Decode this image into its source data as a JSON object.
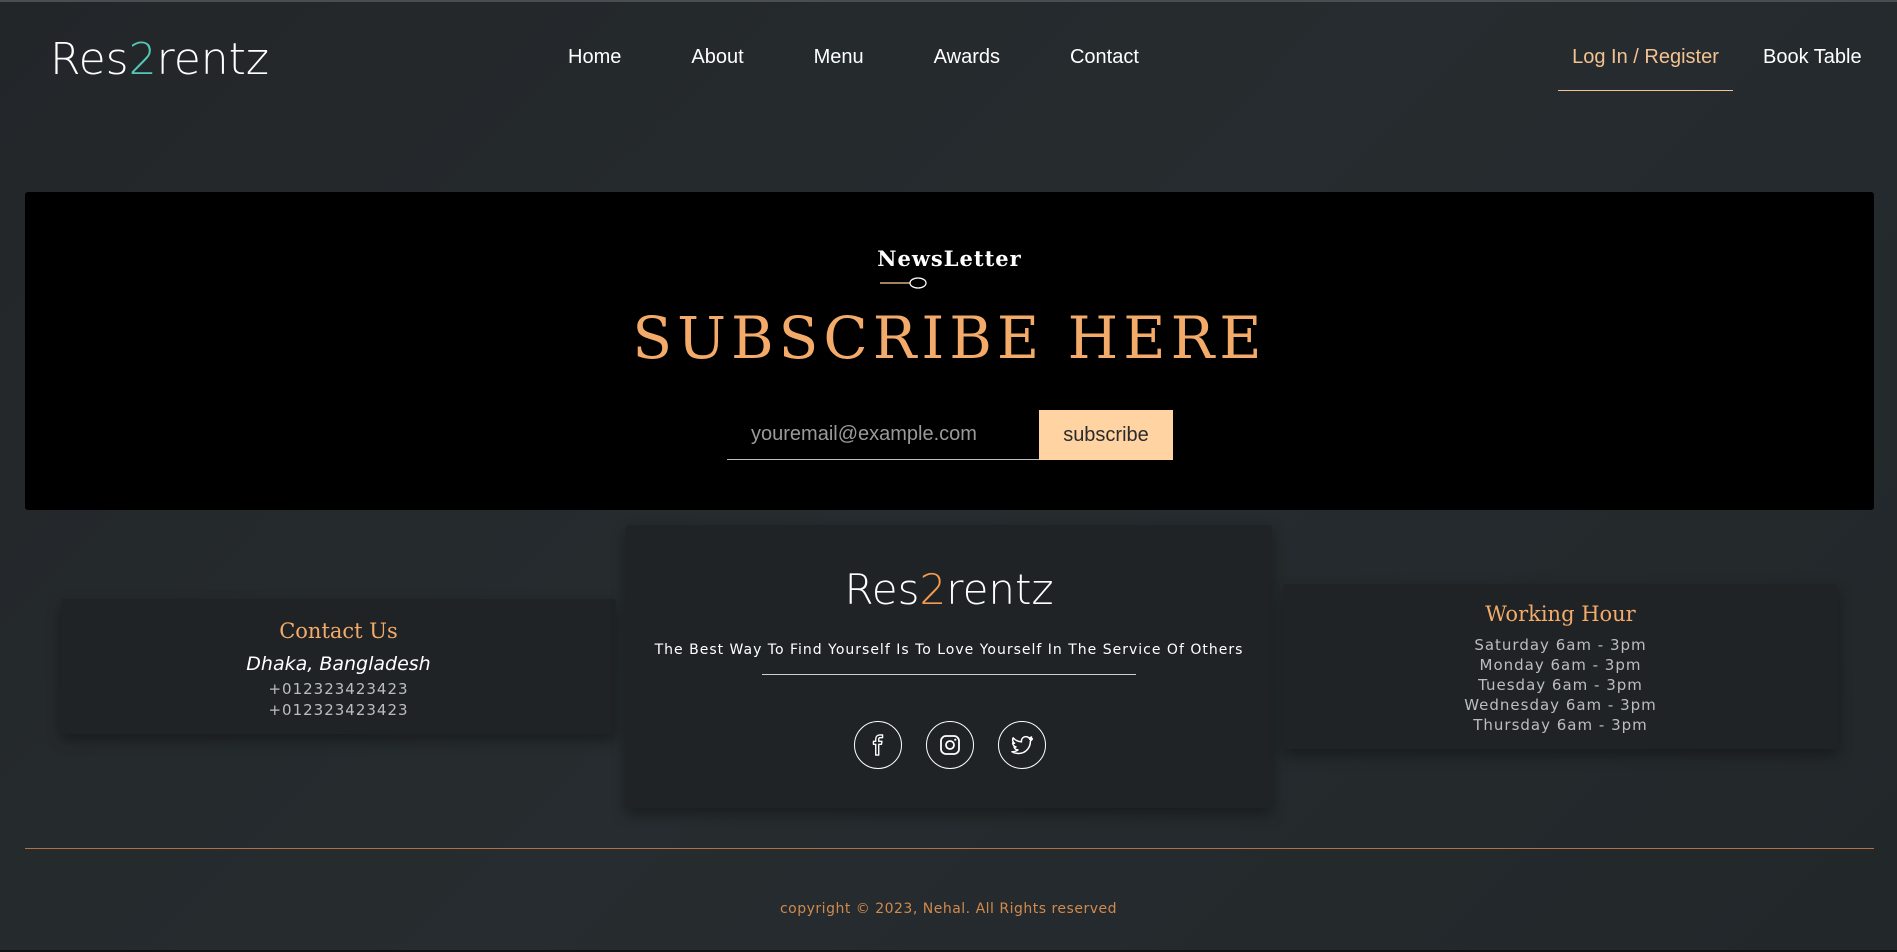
{
  "header": {
    "logo": {
      "prefix": "Res",
      "accent": "2",
      "suffix": "rentz"
    },
    "nav": [
      "Home",
      "About",
      "Menu",
      "Awards",
      "Contact"
    ],
    "login_label": "Log In / Register",
    "book_label": "Book Table"
  },
  "newsletter": {
    "label": "NewsLetter",
    "title": "SUBSCRIBE HERE",
    "email_placeholder": "youremail@example.com",
    "button_label": "subscribe"
  },
  "contact": {
    "title": "Contact Us",
    "city": "Dhaka, Bangladesh",
    "phones": [
      "+012323423423",
      "+012323423423"
    ]
  },
  "brand": {
    "logo": {
      "prefix": "Res",
      "accent": "2",
      "suffix": "rentz"
    },
    "tagline": "The Best Way To Find Yourself Is To Love Yourself In The Service Of Others",
    "socials": [
      "facebook-icon",
      "instagram-icon",
      "twitter-icon"
    ]
  },
  "hours": {
    "title": "Working Hour",
    "items": [
      "Saturday 6am - 3pm",
      "Monday 6am - 3pm",
      "Tuesday 6am - 3pm",
      "Wednesday 6am - 3pm",
      "Thursday 6am - 3pm"
    ]
  },
  "footer": {
    "copyright": "copyright © 2023, Nehal. All Rights reserved"
  },
  "colors": {
    "background": "#23282b",
    "accent_orange": "#f4ab6a",
    "logo_teal": "#54c8b6",
    "button_bg": "#ffd3a2"
  }
}
